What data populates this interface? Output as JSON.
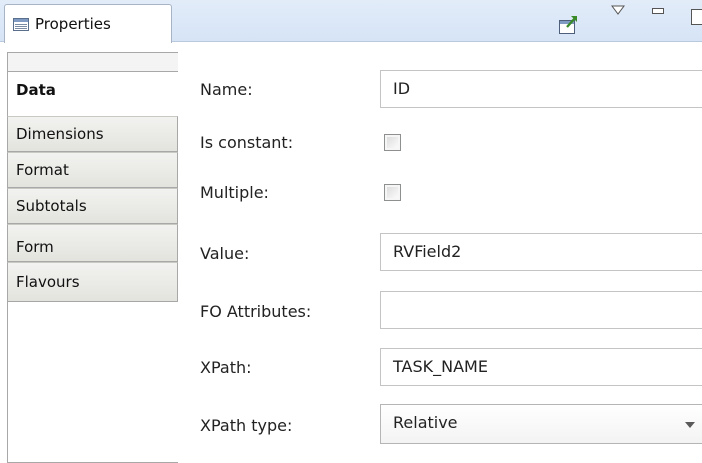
{
  "view": {
    "title": "Properties",
    "icons": {
      "properties": "properties-view-icon",
      "pin": "pin-to-selection-icon",
      "menu": "view-menu-icon",
      "minimize": "minimize-icon",
      "maximize": "maximize-icon"
    },
    "colors": {
      "titlebar": "#d6e4f6",
      "tab_border": "#a8a8a8"
    }
  },
  "tabs": [
    {
      "label": "Data",
      "active": true
    },
    {
      "label": "Dimensions",
      "active": false
    },
    {
      "label": "Format",
      "active": false
    },
    {
      "label": "Subtotals",
      "active": false
    },
    {
      "label": "Form",
      "active": false
    },
    {
      "label": "Flavours",
      "active": false
    }
  ],
  "form": {
    "name": {
      "label": "Name:",
      "value": "ID"
    },
    "is_constant": {
      "label": "Is constant:",
      "checked": false
    },
    "multiple": {
      "label": "Multiple:",
      "checked": false
    },
    "value": {
      "label": "Value:",
      "value": "RVField2"
    },
    "fo_attributes": {
      "label": "FO Attributes:",
      "value": ""
    },
    "xpath": {
      "label": "XPath:",
      "value": "TASK_NAME"
    },
    "xpath_type": {
      "label": "XPath type:",
      "selected": "Relative"
    }
  }
}
